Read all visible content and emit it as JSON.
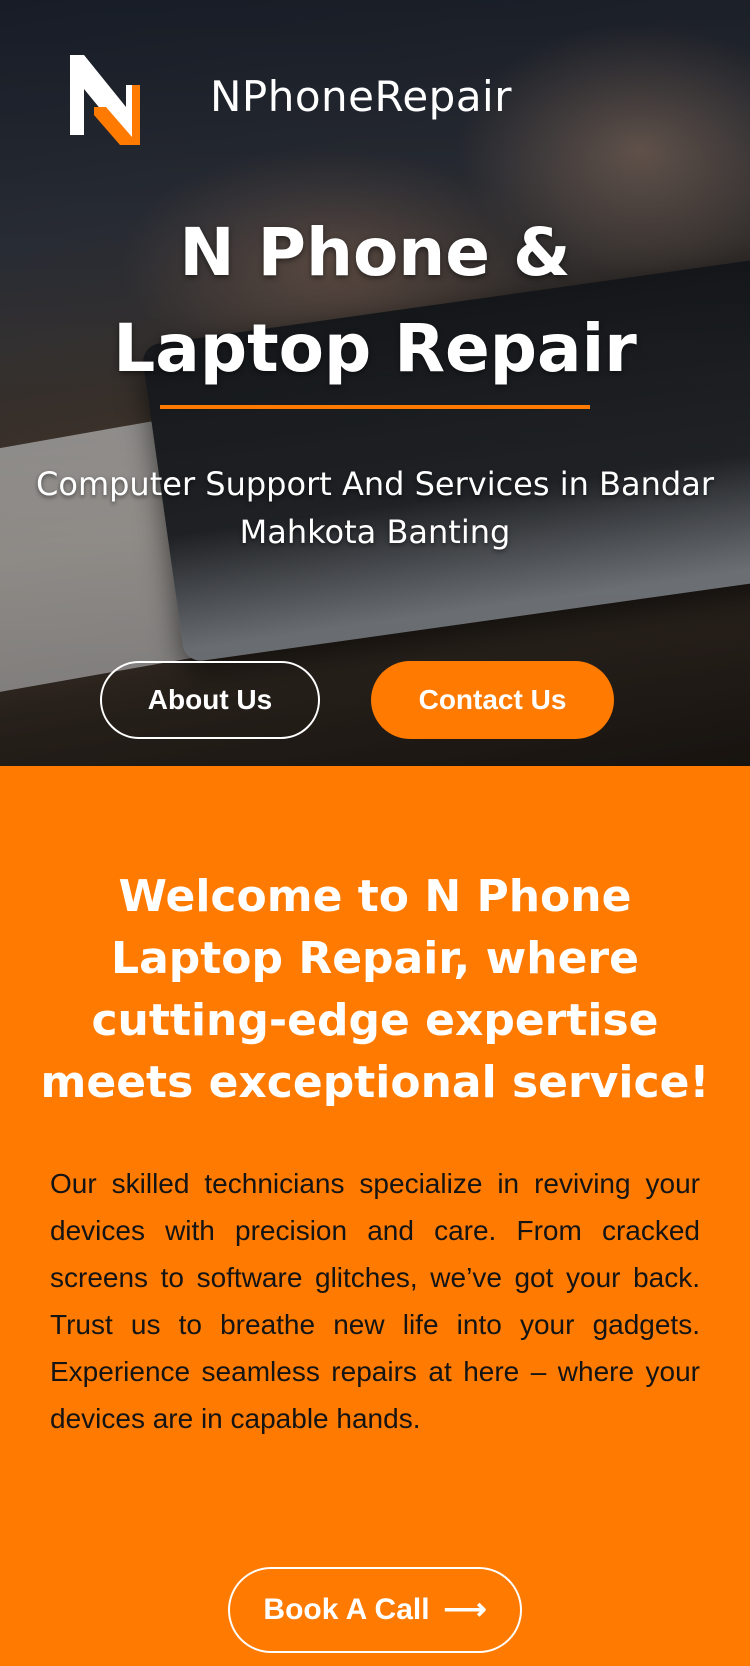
{
  "header": {
    "brand_name": "NPhoneRepair",
    "logo_icon": "n-logo-icon"
  },
  "hero": {
    "title_line1": "N Phone &",
    "title_line2": "Laptop Repair",
    "subtitle": "Computer Support And Services in Bandar Mahkota Banting",
    "about_button": "About Us",
    "contact_button": "Contact Us"
  },
  "welcome": {
    "heading": "Welcome to N Phone Laptop Repair, where cutting-edge expertise meets exceptional service!",
    "body": "Our skilled technicians specialize in reviving your devices with precision and care. From cracked screens to software glitches, we’ve got your back. Trust us to breathe new life into your gadgets. Experience seamless repairs at here – where your devices are in capable hands.",
    "cta_label": "Book A Call",
    "cta_icon": "arrow-right-icon"
  },
  "colors": {
    "accent": "#ff7a00",
    "text_dark": "#141414",
    "text_light": "#ffffff"
  }
}
